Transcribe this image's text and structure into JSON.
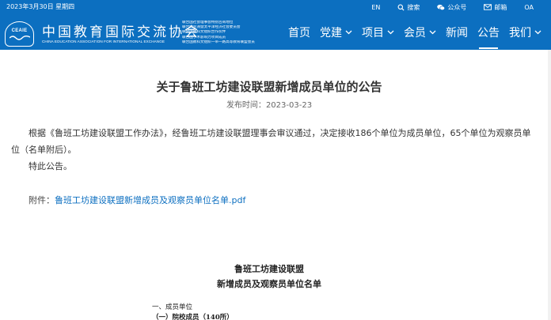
{
  "topbar": {
    "date": "2023年3月30日  星期四",
    "links": [
      {
        "label": "EN",
        "icon": ""
      },
      {
        "label": "搜索",
        "icon": "search-icon"
      },
      {
        "label": "公众号",
        "icon": "wechat-icon"
      },
      {
        "label": "邮箱",
        "icon": "mail-icon"
      },
      {
        "label": "OA",
        "icon": ""
      }
    ]
  },
  "logo": {
    "abbr": "CEAIE",
    "name_cn": "中国教育国际交流协会",
    "name_en": "CHINA EDUCATION ASSOCIATION FOR INTERNATIONAL EXCHANGE",
    "sub_lines": [
      "联合国社会理事会特别咨商地位",
      "联合国亚洲暨太平洋经济社会委员会",
      "联合国教科文组织合作伙伴",
      "联合国学术影响力项目成员",
      "联合国教科文组织一带一路高等教育联盟会员"
    ]
  },
  "nav": {
    "items": [
      {
        "label": "首页",
        "dropdown": false,
        "active": false
      },
      {
        "label": "党建",
        "dropdown": true,
        "active": false
      },
      {
        "label": "项目",
        "dropdown": true,
        "active": false
      },
      {
        "label": "会员",
        "dropdown": true,
        "active": false
      },
      {
        "label": "新闻",
        "dropdown": false,
        "active": false
      },
      {
        "label": "公告",
        "dropdown": false,
        "active": true
      },
      {
        "label": "我们",
        "dropdown": true,
        "active": false
      }
    ]
  },
  "article": {
    "title": "关于鲁班工坊建设联盟新增成员单位的公告",
    "publish_label": "发布时间：",
    "publish_date": "2023-03-23",
    "paragraph1": "根据《鲁班工坊建设联盟工作办法》，经鲁班工坊建设联盟理事会审议通过，决定接收186个单位为成员单位，65个单位为观察员单位（名单附后）。",
    "paragraph2": "特此公告。",
    "attachment_label": "附件：",
    "attachment_link": "鲁班工坊建设联盟新增成员及观察员单位名单.pdf"
  },
  "embedded_doc": {
    "title_line1": "鲁班工坊建设联盟",
    "title_line2": "新增成员及观察员单位名单",
    "line1": "一、成员单位",
    "line2": "（一）院校成员（140所）"
  },
  "colors": {
    "header_bg": "#0c6fc0",
    "link": "#0c6fc0"
  }
}
